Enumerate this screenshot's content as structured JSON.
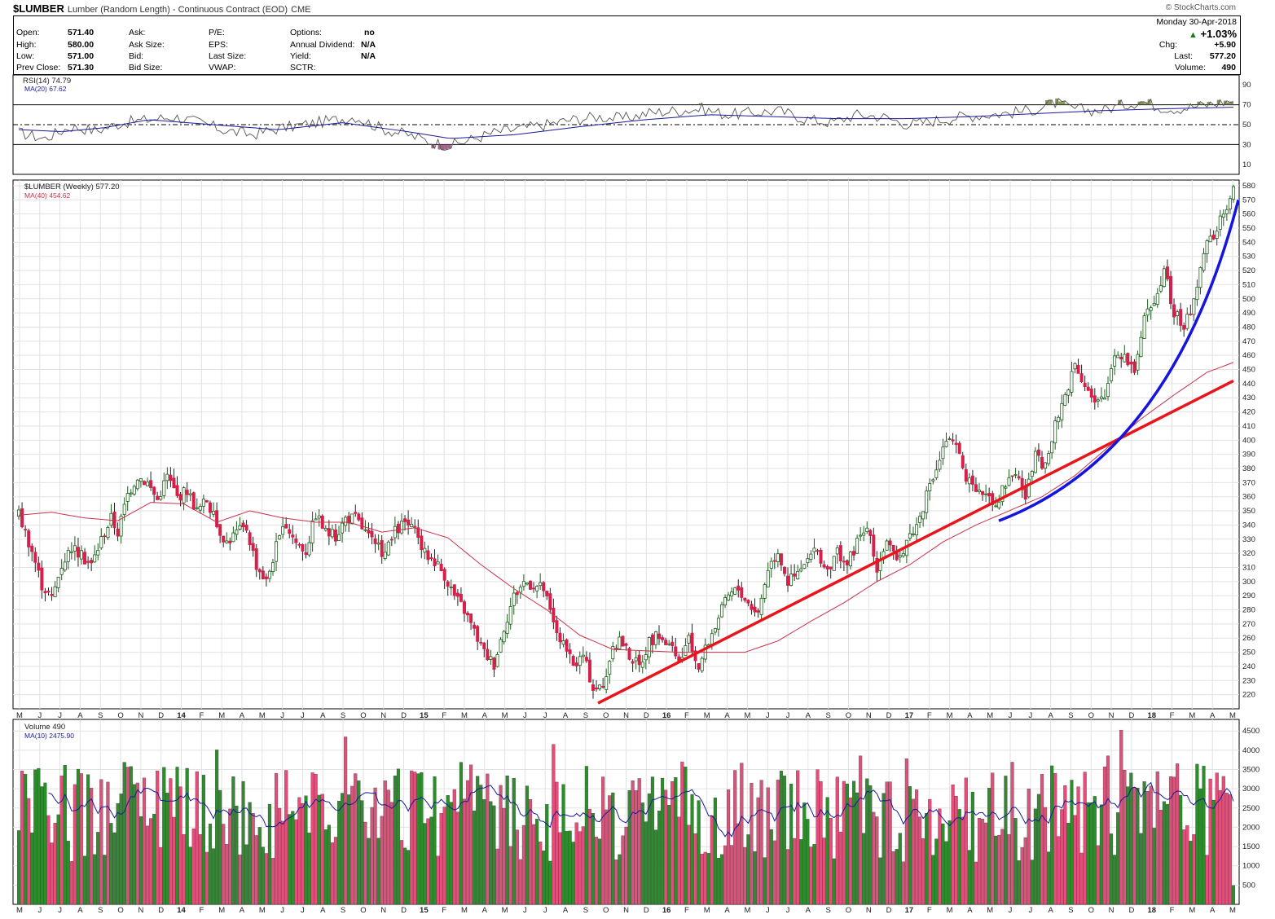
{
  "header": {
    "symbol": "$LUMBER",
    "description": "Lumber (Random Length) - Continuous Contract (EOD)",
    "exchange": "CME",
    "logo": "© StockCharts.com"
  },
  "quote": {
    "left": [
      {
        "label": "Open:",
        "value": "571.40"
      },
      {
        "label": "High:",
        "value": "580.00"
      },
      {
        "label": "Low:",
        "value": "571.00"
      },
      {
        "label": "Prev Close:",
        "value": "571.30"
      }
    ],
    "col2": [
      "Ask:",
      "Ask Size:",
      "Bid:",
      "Bid Size:"
    ],
    "col3": [
      "P/E:",
      "EPS:",
      "Last Size:",
      "VWAP:"
    ],
    "col4": [
      {
        "label": "Options:",
        "value": "no"
      },
      {
        "label": "Annual Dividend:",
        "value": "N/A"
      },
      {
        "label": "Yield:",
        "value": "N/A"
      },
      {
        "label": "SCTR:",
        "value": ""
      }
    ],
    "date": "Monday  30-Apr-2018",
    "change_pct": "+1.03%",
    "right": [
      {
        "label": "Chg:",
        "value": "+5.90"
      },
      {
        "label": "Last:",
        "value": "577.20"
      },
      {
        "label": "Volume:",
        "value": "490"
      }
    ]
  },
  "colors": {
    "up": "#2e8b2e",
    "down": "#d6204b",
    "ma_price": "#c8324c",
    "ma_blue": "#1a1a99",
    "trend_red": "#e8161c",
    "trend_blue": "#1515dd",
    "vol_up": "#2e8b2e",
    "vol_down": "#e0507a"
  },
  "chart_data": [
    {
      "type": "line",
      "title": "RSI(14) 74.79",
      "series": [
        {
          "name": "RSI(14) 74.79"
        },
        {
          "name": "MA(20) 67.62"
        }
      ],
      "y_ticks": [
        90,
        70,
        50,
        30,
        10
      ],
      "ylim": [
        0,
        100
      ],
      "reference_lines": [
        70,
        50,
        30
      ],
      "rsi_anchors": [
        [
          0,
          42
        ],
        [
          6,
          36
        ],
        [
          12,
          48
        ],
        [
          18,
          44
        ],
        [
          24,
          52
        ],
        [
          30,
          55
        ],
        [
          36,
          58
        ],
        [
          42,
          52
        ],
        [
          48,
          44
        ],
        [
          54,
          40
        ],
        [
          60,
          46
        ],
        [
          66,
          50
        ],
        [
          72,
          54
        ],
        [
          78,
          58
        ],
        [
          84,
          46
        ],
        [
          90,
          40
        ],
        [
          96,
          32
        ],
        [
          100,
          29
        ],
        [
          104,
          34
        ],
        [
          110,
          42
        ],
        [
          116,
          46
        ],
        [
          122,
          50
        ],
        [
          128,
          55
        ],
        [
          134,
          58
        ],
        [
          140,
          56
        ],
        [
          146,
          62
        ],
        [
          152,
          64
        ],
        [
          158,
          66
        ],
        [
          164,
          60
        ],
        [
          170,
          62
        ],
        [
          176,
          64
        ],
        [
          182,
          56
        ],
        [
          188,
          52
        ],
        [
          194,
          60
        ],
        [
          200,
          58
        ],
        [
          206,
          50
        ],
        [
          212,
          54
        ],
        [
          218,
          58
        ],
        [
          224,
          60
        ],
        [
          230,
          62
        ],
        [
          236,
          66
        ],
        [
          240,
          72
        ],
        [
          244,
          66
        ],
        [
          250,
          64
        ],
        [
          256,
          70
        ],
        [
          260,
          74
        ],
        [
          264,
          68
        ],
        [
          268,
          66
        ],
        [
          272,
          68
        ],
        [
          278,
          72
        ],
        [
          282,
          75
        ]
      ],
      "ma_anchors": [
        [
          0,
          45
        ],
        [
          10,
          43
        ],
        [
          20,
          47
        ],
        [
          30,
          55
        ],
        [
          45,
          50
        ],
        [
          60,
          45
        ],
        [
          75,
          52
        ],
        [
          90,
          43
        ],
        [
          100,
          36
        ],
        [
          115,
          40
        ],
        [
          130,
          48
        ],
        [
          145,
          55
        ],
        [
          160,
          60
        ],
        [
          175,
          58
        ],
        [
          190,
          56
        ],
        [
          205,
          56
        ],
        [
          220,
          58
        ],
        [
          235,
          61
        ],
        [
          250,
          64
        ],
        [
          265,
          66
        ],
        [
          282,
          67.6
        ]
      ]
    },
    {
      "type": "line",
      "title": "$LUMBER (Weekly) 577.20",
      "series": [
        {
          "name": "$LUMBER (Weekly) 577.20"
        },
        {
          "name": "MA(40) 454.62"
        }
      ],
      "y_ticks": [
        580,
        570,
        560,
        550,
        540,
        530,
        520,
        510,
        500,
        490,
        480,
        470,
        460,
        450,
        440,
        430,
        420,
        410,
        400,
        390,
        380,
        370,
        360,
        350,
        340,
        330,
        320,
        310,
        300,
        290,
        280,
        270,
        260,
        250,
        240,
        230,
        220
      ],
      "ylim": [
        210,
        584
      ],
      "price_anchors": [
        [
          0,
          348
        ],
        [
          4,
          322
        ],
        [
          7,
          298
        ],
        [
          10,
          288
        ],
        [
          13,
          312
        ],
        [
          16,
          325
        ],
        [
          19,
          318
        ],
        [
          22,
          312
        ],
        [
          25,
          330
        ],
        [
          28,
          345
        ],
        [
          30,
          335
        ],
        [
          33,
          362
        ],
        [
          36,
          375
        ],
        [
          39,
          370
        ],
        [
          42,
          358
        ],
        [
          45,
          375
        ],
        [
          48,
          360
        ],
        [
          51,
          365
        ],
        [
          54,
          350
        ],
        [
          57,
          358
        ],
        [
          60,
          340
        ],
        [
          63,
          328
        ],
        [
          66,
          335
        ],
        [
          69,
          338
        ],
        [
          72,
          312
        ],
        [
          75,
          300
        ],
        [
          78,
          325
        ],
        [
          81,
          340
        ],
        [
          84,
          328
        ],
        [
          87,
          322
        ],
        [
          90,
          348
        ],
        [
          93,
          335
        ],
        [
          96,
          332
        ],
        [
          99,
          345
        ],
        [
          102,
          345
        ],
        [
          105,
          335
        ],
        [
          108,
          325
        ],
        [
          111,
          320
        ],
        [
          114,
          335
        ],
        [
          117,
          342
        ],
        [
          120,
          335
        ],
        [
          123,
          320
        ],
        [
          126,
          315
        ],
        [
          129,
          305
        ],
        [
          132,
          290
        ],
        [
          135,
          280
        ],
        [
          138,
          265
        ],
        [
          141,
          250
        ],
        [
          144,
          242
        ],
        [
          147,
          268
        ],
        [
          150,
          290
        ],
        [
          153,
          300
        ],
        [
          156,
          298
        ],
        [
          159,
          295
        ],
        [
          162,
          270
        ],
        [
          165,
          255
        ],
        [
          168,
          240
        ],
        [
          171,
          248
        ],
        [
          174,
          225
        ],
        [
          177,
          225
        ],
        [
          179,
          245
        ],
        [
          182,
          260
        ],
        [
          185,
          248
        ],
        [
          188,
          240
        ],
        [
          191,
          258
        ],
        [
          194,
          262
        ],
        [
          197,
          255
        ],
        [
          200,
          242
        ],
        [
          203,
          258
        ],
        [
          206,
          240
        ],
        [
          209,
          258
        ],
        [
          212,
          275
        ],
        [
          215,
          290
        ],
        [
          218,
          295
        ],
        [
          221,
          285
        ],
        [
          224,
          278
        ],
        [
          227,
          310
        ],
        [
          230,
          322
        ],
        [
          233,
          300
        ],
        [
          236,
          305
        ],
        [
          239,
          315
        ],
        [
          242,
          322
        ],
        [
          245,
          305
        ],
        [
          248,
          322
        ],
        [
          251,
          312
        ],
        [
          254,
          328
        ],
        [
          257,
          338
        ],
        [
          260,
          310
        ],
        [
          263,
          330
        ],
        [
          266,
          312
        ],
        [
          269,
          330
        ],
        [
          272,
          340
        ],
        [
          275,
          360
        ],
        [
          278,
          380
        ],
        [
          281,
          400
        ],
        [
          284,
          395
        ],
        [
          287,
          375
        ],
        [
          290,
          360
        ],
        [
          293,
          365
        ],
        [
          296,
          355
        ],
        [
          299,
          370
        ],
        [
          302,
          378
        ],
        [
          305,
          360
        ],
        [
          308,
          388
        ],
        [
          311,
          380
        ],
        [
          314,
          410
        ],
        [
          317,
          432
        ],
        [
          320,
          455
        ],
        [
          323,
          440
        ],
        [
          326,
          425
        ],
        [
          329,
          430
        ],
        [
          332,
          462
        ],
        [
          335,
          460
        ],
        [
          338,
          450
        ],
        [
          341,
          485
        ],
        [
          344,
          500
        ],
        [
          347,
          520
        ],
        [
          350,
          490
        ],
        [
          353,
          480
        ],
        [
          356,
          498
        ],
        [
          359,
          535
        ],
        [
          362,
          545
        ],
        [
          365,
          560
        ],
        [
          368,
          577
        ]
      ],
      "ma_anchors": [
        [
          0,
          347
        ],
        [
          10,
          349
        ],
        [
          20,
          345
        ],
        [
          30,
          343
        ],
        [
          40,
          356
        ],
        [
          50,
          355
        ],
        [
          60,
          342
        ],
        [
          70,
          350
        ],
        [
          80,
          345
        ],
        [
          90,
          342
        ],
        [
          100,
          342
        ],
        [
          110,
          335
        ],
        [
          120,
          338
        ],
        [
          130,
          331
        ],
        [
          140,
          312
        ],
        [
          150,
          295
        ],
        [
          160,
          280
        ],
        [
          170,
          262
        ],
        [
          180,
          252
        ],
        [
          190,
          251
        ],
        [
          200,
          250
        ],
        [
          210,
          250
        ],
        [
          220,
          250
        ],
        [
          230,
          258
        ],
        [
          240,
          272
        ],
        [
          250,
          285
        ],
        [
          260,
          300
        ],
        [
          270,
          312
        ],
        [
          280,
          328
        ],
        [
          290,
          340
        ],
        [
          300,
          350
        ],
        [
          310,
          360
        ],
        [
          320,
          375
        ],
        [
          330,
          395
        ],
        [
          340,
          415
        ],
        [
          350,
          432
        ],
        [
          360,
          448
        ],
        [
          368,
          455
        ]
      ],
      "trendlines": [
        {
          "color": "red",
          "from": [
            "2015-09",
            214
          ],
          "to": [
            "2018-05",
            442
          ]
        },
        {
          "color": "blue",
          "style": "curve",
          "from": [
            "2017-06",
            343
          ],
          "to": [
            "2018-05",
            570
          ]
        }
      ]
    },
    {
      "type": "bar",
      "title": "Volume 490",
      "series": [
        {
          "name": "Volume 490"
        },
        {
          "name": "MA(10) 2475.90"
        }
      ],
      "y_ticks": [
        4500,
        4000,
        3500,
        3000,
        2500,
        2000,
        1500,
        1000,
        500
      ],
      "ylim": [
        0,
        4800
      ],
      "last_volume": 490,
      "ma_last": 2475.9
    }
  ],
  "x_axis": {
    "labels": [
      "M",
      "J",
      "J",
      "A",
      "S",
      "O",
      "N",
      "D",
      "14",
      "F",
      "M",
      "A",
      "M",
      "J",
      "J",
      "A",
      "S",
      "O",
      "N",
      "D",
      "15",
      "F",
      "M",
      "A",
      "M",
      "J",
      "J",
      "A",
      "S",
      "O",
      "N",
      "D",
      "16",
      "F",
      "M",
      "A",
      "M",
      "J",
      "J",
      "A",
      "S",
      "O",
      "N",
      "D",
      "17",
      "F",
      "M",
      "A",
      "M",
      "J",
      "J",
      "A",
      "S",
      "O",
      "N",
      "D",
      "18",
      "F",
      "M",
      "A",
      "M"
    ],
    "bold": [
      "14",
      "15",
      "16",
      "17",
      "18"
    ]
  }
}
